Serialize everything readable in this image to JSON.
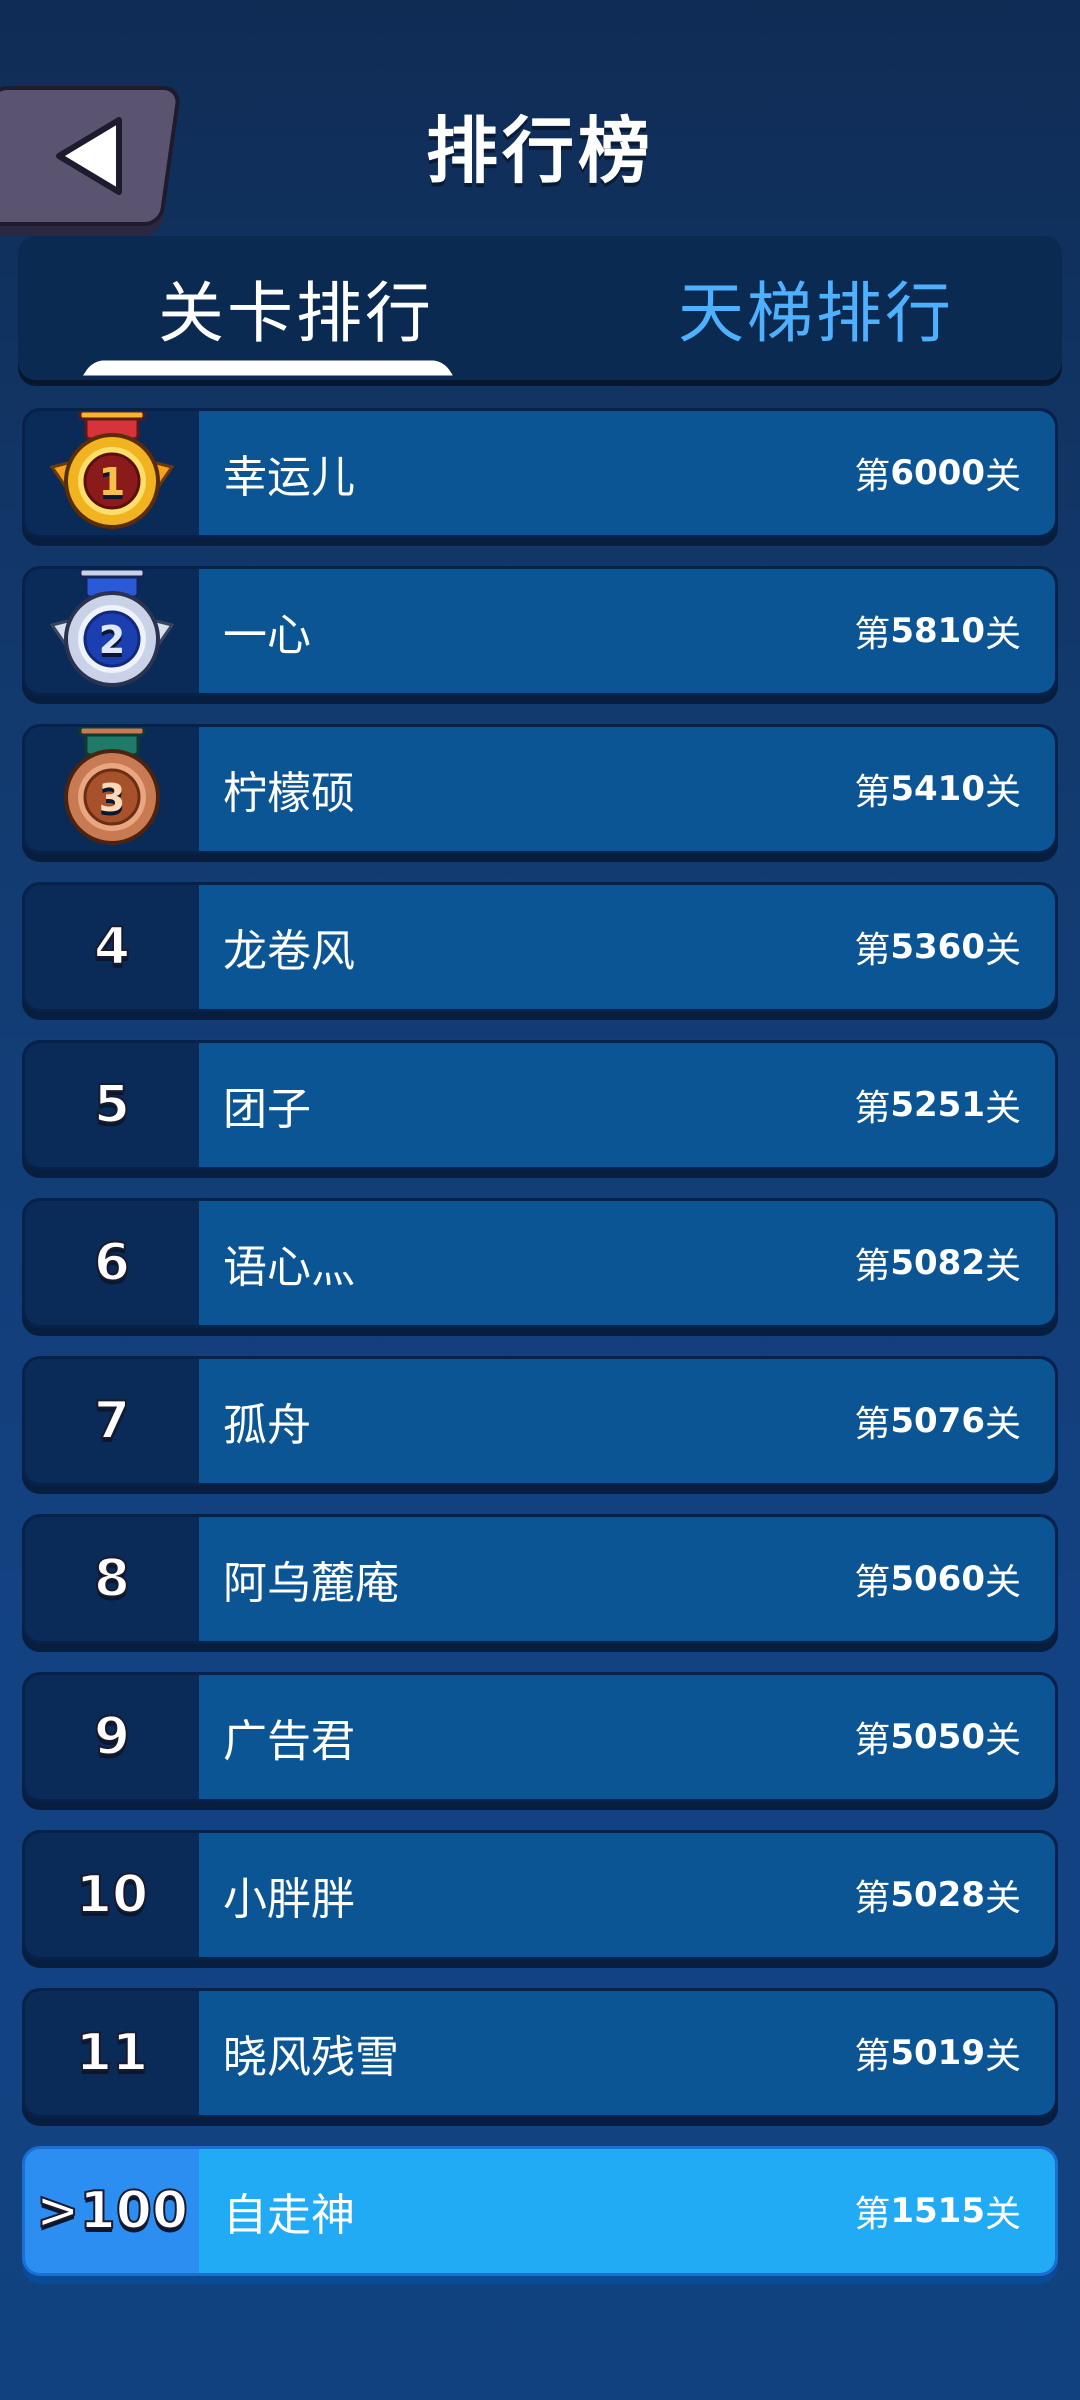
{
  "header": {
    "title": "排行榜",
    "back_icon": "triangle-left"
  },
  "tabs": [
    {
      "label": "关卡排行",
      "active": true
    },
    {
      "label": "天梯排行",
      "active": false
    }
  ],
  "colors": {
    "background": "#123a6e",
    "row_bg": "#0c5595",
    "rank_bg": "#0a2a57",
    "self_row_bg": "#22abf5",
    "inactive_tab": "#4fb0ff",
    "gold": "#f0a500",
    "silver": "#c9d2e6",
    "bronze": "#c87a52"
  },
  "leaderboard": [
    {
      "rank": "1",
      "medal": "gold-medal",
      "name": "幸运儿",
      "prefix": "第",
      "level": "6000",
      "suffix": "关"
    },
    {
      "rank": "2",
      "medal": "silver-medal",
      "name": "一心",
      "prefix": "第",
      "level": "5810",
      "suffix": "关"
    },
    {
      "rank": "3",
      "medal": "bronze-medal",
      "name": "柠檬硕",
      "prefix": "第",
      "level": "5410",
      "suffix": "关"
    },
    {
      "rank": "4",
      "name": "龙卷风",
      "prefix": "第",
      "level": "5360",
      "suffix": "关"
    },
    {
      "rank": "5",
      "name": "团子",
      "prefix": "第",
      "level": "5251",
      "suffix": "关"
    },
    {
      "rank": "6",
      "name": "语心灬",
      "prefix": "第",
      "level": "5082",
      "suffix": "关"
    },
    {
      "rank": "7",
      "name": "孤舟",
      "prefix": "第",
      "level": "5076",
      "suffix": "关"
    },
    {
      "rank": "8",
      "name": "阿乌麓庵",
      "prefix": "第",
      "level": "5060",
      "suffix": "关"
    },
    {
      "rank": "9",
      "name": "广告君",
      "prefix": "第",
      "level": "5050",
      "suffix": "关"
    },
    {
      "rank": "10",
      "name": "小胖胖",
      "prefix": "第",
      "level": "5028",
      "suffix": "关"
    },
    {
      "rank": "11",
      "name": "晓风残雪",
      "prefix": "第",
      "level": "5019",
      "suffix": "关"
    }
  ],
  "self": {
    "rank": ">100",
    "name": "自走神",
    "prefix": "第",
    "level": "1515",
    "suffix": "关"
  }
}
